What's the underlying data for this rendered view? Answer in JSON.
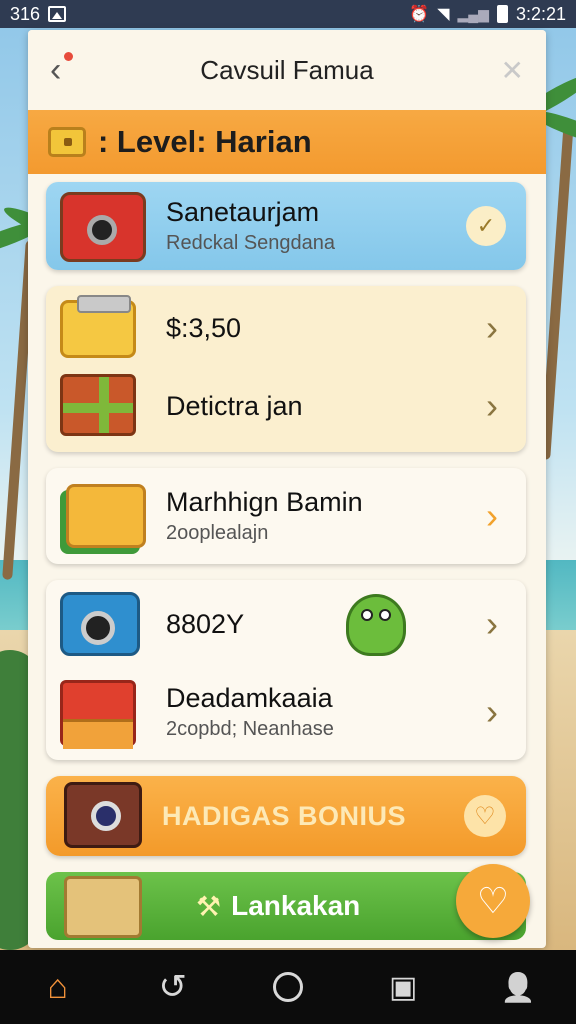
{
  "status_bar": {
    "left_text": "316",
    "time": "3:2:21"
  },
  "header": {
    "title": "Cavsuil Famua"
  },
  "level_bar": {
    "label": ": Level: Harian"
  },
  "rows": {
    "r1": {
      "primary": "Sanetaurjam",
      "secondary": "Redckal Sengdana"
    },
    "r2": {
      "primary": "$:3,50"
    },
    "r3": {
      "primary": "Detictra jan"
    },
    "r4": {
      "primary": "Marhhign Bamin",
      "secondary": "2ooplealajn"
    },
    "r5": {
      "primary": "8802Y"
    },
    "r6": {
      "primary": "Deadamkaaia",
      "secondary": "2copbd; Neanhase"
    }
  },
  "bonus_button": {
    "label": "HADIGAS BONIUS"
  },
  "action_button": {
    "label": "Lankakan"
  },
  "icons": {
    "chevron": "›",
    "check": "✓",
    "heart": "♡",
    "close": "✕",
    "back": "‹",
    "tools": "⚒",
    "nav_home": "⌂",
    "nav_back": "↺",
    "nav_profile": "👤"
  },
  "colors": {
    "accent_orange": "#f39a2f",
    "accent_green": "#4aa32e",
    "card_blue": "#84c7ea"
  }
}
